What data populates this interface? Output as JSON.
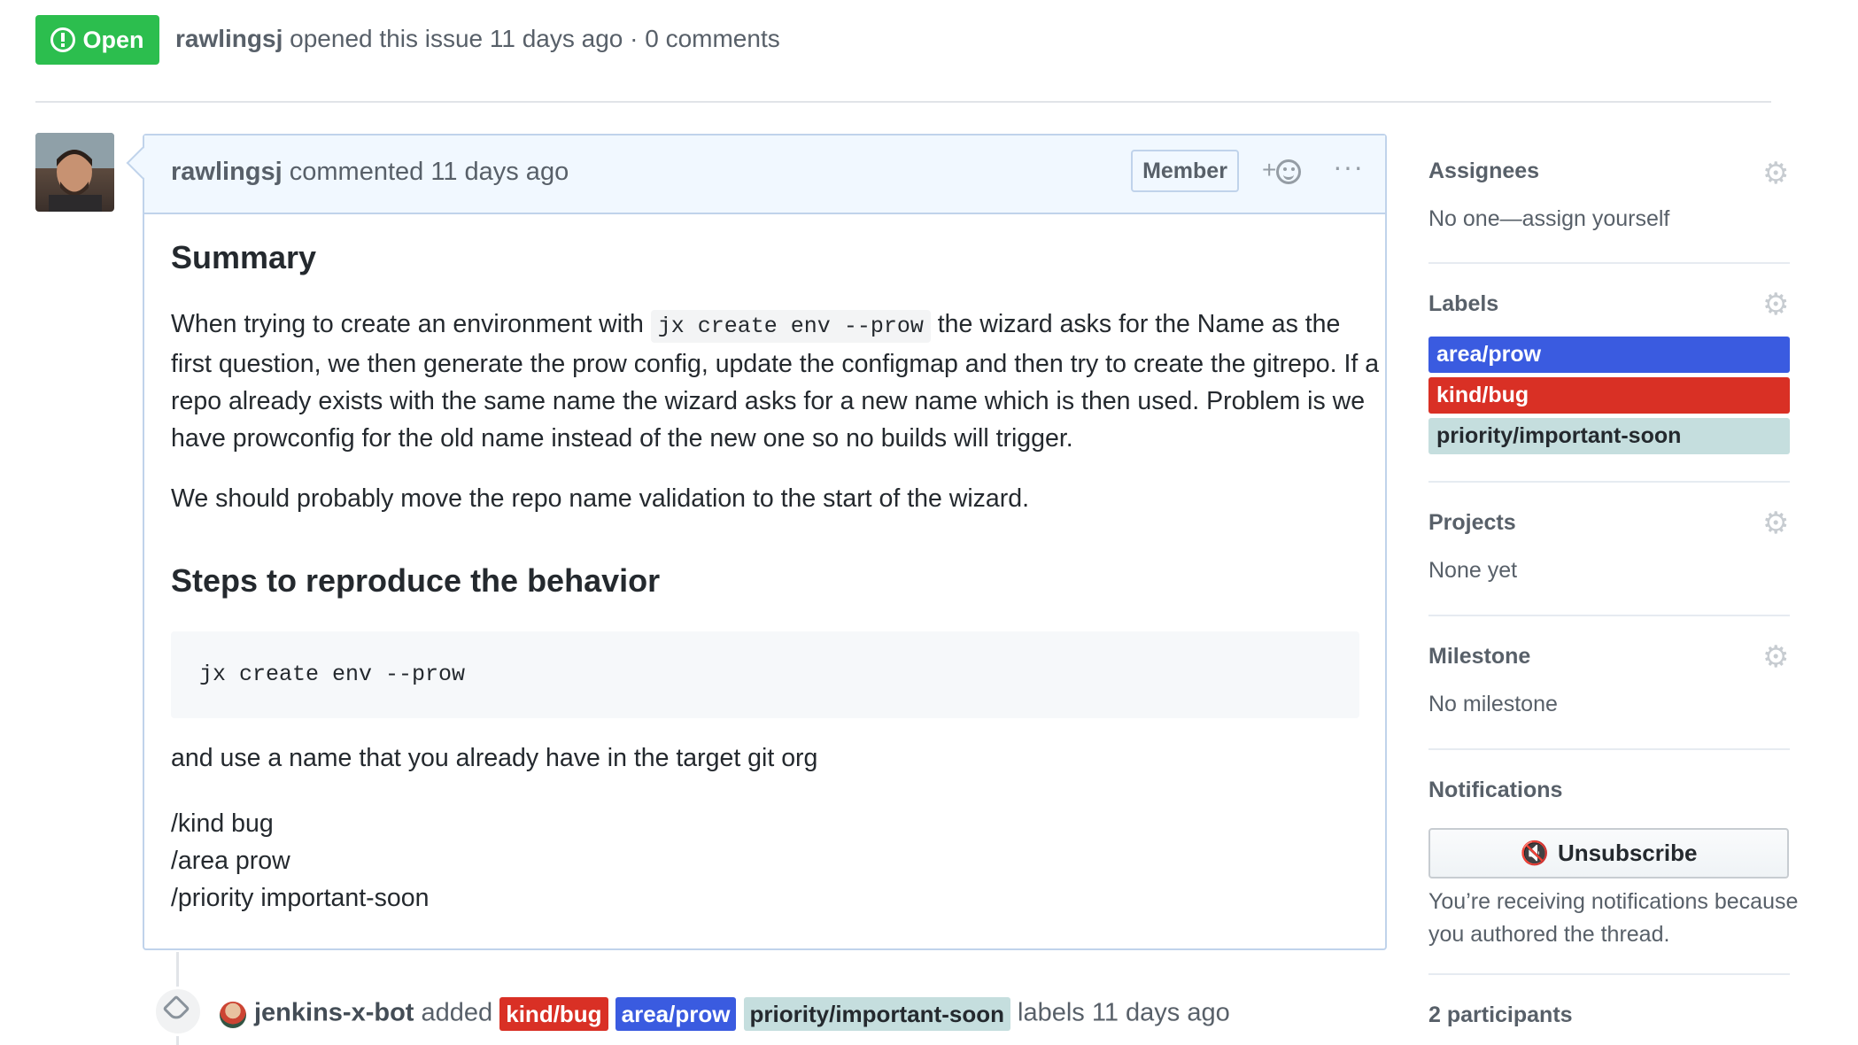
{
  "header": {
    "state": "Open",
    "author": "rawlingsj",
    "meta": "opened this issue 11 days ago · 0 comments"
  },
  "comment": {
    "author": "rawlingsj",
    "action": "commented 11 days ago",
    "badge": "Member",
    "reaction_plus": "+",
    "more": "···",
    "summary_heading": "Summary",
    "p1_before": "When trying to create an environment with",
    "p1_code": "jx create env --prow",
    "p1_after": "the wizard asks for the Name as the first question, we then generate the prow config, update the configmap and then try to create the gitrepo. If a repo already exists with the same name the wizard asks for a new name which is then used. Problem is we have prowconfig for the old name instead of the new one so no builds will trigger.",
    "p2": "We should probably move the repo name validation to the start of the wizard.",
    "steps_heading": "Steps to reproduce the behavior",
    "code_block": "jx create env --prow",
    "p3": "and use a name that you already have in the target git org",
    "cmd1": "/kind bug",
    "cmd2": "/area prow",
    "cmd3": "/priority important-soon"
  },
  "event": {
    "actor": "jenkins-x-bot",
    "verb": "added",
    "labels": [
      "kind/bug",
      "area/prow",
      "priority/important-soon"
    ],
    "suffix": "labels 11 days ago"
  },
  "sidebar": {
    "assignees_title": "Assignees",
    "assignees_value": "No one—assign yourself",
    "labels_title": "Labels",
    "labels": [
      {
        "name": "area/prow",
        "color": "#3a5be0"
      },
      {
        "name": "kind/bug",
        "color": "#d93025"
      },
      {
        "name": "priority/important-soon",
        "color": "#c5dede"
      }
    ],
    "projects_title": "Projects",
    "projects_value": "None yet",
    "milestone_title": "Milestone",
    "milestone_value": "No milestone",
    "notifications_title": "Notifications",
    "unsubscribe_label": "Unsubscribe",
    "notification_reason": "You’re receiving notifications because you authored the thread.",
    "participants": "2 participants"
  },
  "icons": {
    "state": "issue-opened-icon",
    "reaction": "smiley-icon",
    "event": "tag-icon",
    "settings": "gear-icon",
    "unsubscribe": "mute-icon"
  }
}
